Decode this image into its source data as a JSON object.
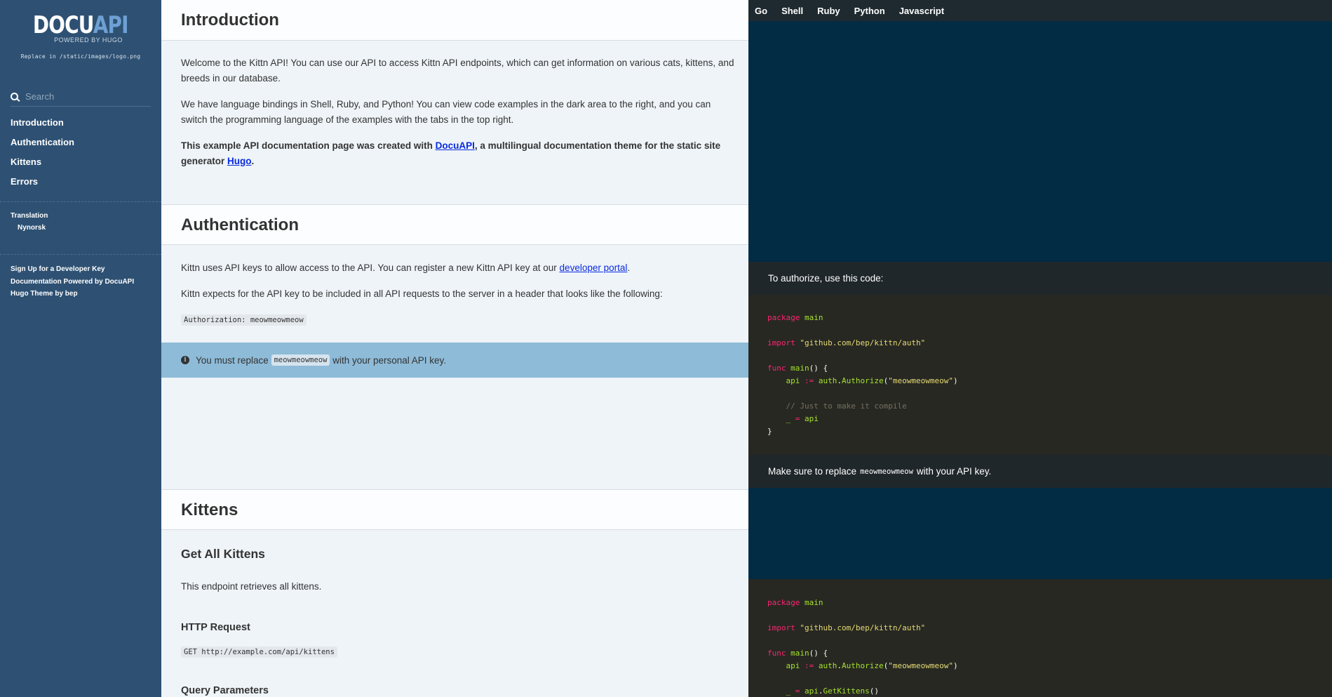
{
  "sidebar": {
    "logo_docu": "DOCU",
    "logo_api": "API",
    "logo_powered": "POWERED BY HUGO",
    "logo_note": "Replace in /static/images/logo.png",
    "search_placeholder": "Search",
    "nav": [
      "Introduction",
      "Authentication",
      "Kittens",
      "Errors"
    ],
    "translation_heading": "Translation",
    "translation_lang": "Nynorsk",
    "footer_links": [
      "Sign Up for a Developer Key",
      "Documentation Powered by DocuAPI",
      "Hugo Theme by bep"
    ]
  },
  "main": {
    "intro_title": "Introduction",
    "intro_p1": "Welcome to the Kittn API! You can use our API to access Kittn API endpoints, which can get information on various cats, kittens, and breeds in our database.",
    "intro_p2": "We have language bindings in Shell, Ruby, and Python! You can view code examples in the dark area to the right, and you can switch the programming language of the examples with the tabs in the top right.",
    "intro_p3_a": "This example API documentation page was created with ",
    "intro_p3_link1": "DocuAPI",
    "intro_p3_b": ", a multilingual documentation theme for the static site generator ",
    "intro_p3_link2": "Hugo",
    "intro_p3_c": ".",
    "auth_title": "Authentication",
    "auth_p1_a": "Kittn uses API keys to allow access to the API. You can register a new Kittn API key at our ",
    "auth_p1_link": "developer portal",
    "auth_p1_b": ".",
    "auth_p2": "Kittn expects for the API key to be included in all API requests to the server in a header that looks like the following:",
    "auth_header_code": "Authorization: meowmeowmeow",
    "notice_a": "You must replace ",
    "notice_code": "meowmeowmeow",
    "notice_b": " with your personal API key.",
    "kittens_title": "Kittens",
    "get_all_title": "Get All Kittens",
    "get_all_desc": "This endpoint retrieves all kittens.",
    "http_request_title": "HTTP Request",
    "http_request_code": "GET http://example.com/api/kittens",
    "query_params_title": "Query Parameters"
  },
  "code_panel": {
    "tabs": [
      "Go",
      "Shell",
      "Ruby",
      "Python",
      "Javascript"
    ],
    "auth_note": "To authorize, use this code:",
    "replace_note_a": "Make sure to replace ",
    "replace_note_code": "meowmeowmeow",
    "replace_note_b": " with your API key.",
    "block1": {
      "l1_kw": "package",
      "l1_nm": "main",
      "l2_kw": "import",
      "l2_str": "\"github.com/bep/kittn/auth\"",
      "l3_kw": "func",
      "l3_fn": "main",
      "l3_rest": "() {",
      "l4_id": "api",
      "l4_op": ":=",
      "l4_pkg": "auth",
      "l4_fn": "Authorize",
      "l4_str": "\"meowmeowmeow\"",
      "l5_cm": "// Just to make it compile",
      "l6_id": "_",
      "l6_op": "=",
      "l6_val": "api",
      "l7": "}"
    },
    "block2": {
      "l1_kw": "package",
      "l1_nm": "main",
      "l2_kw": "import",
      "l2_str": "\"github.com/bep/kittn/auth\"",
      "l3_kw": "func",
      "l3_fn": "main",
      "l3_rest": "() {",
      "l4_id": "api",
      "l4_op": ":=",
      "l4_pkg": "auth",
      "l4_fn": "Authorize",
      "l4_str": "\"meowmeowmeow\"",
      "l5_id": "_",
      "l5_op": "=",
      "l5_obj": "api",
      "l5_fn": "GetKittens",
      "l5_rest": "()"
    }
  },
  "colors": {
    "sidebar_bg": "#2e5173",
    "dark_panel_bg": "#022b44",
    "code_bg": "#272822",
    "notice_bg": "#8ebbd8",
    "link": "#0a2ae0"
  }
}
